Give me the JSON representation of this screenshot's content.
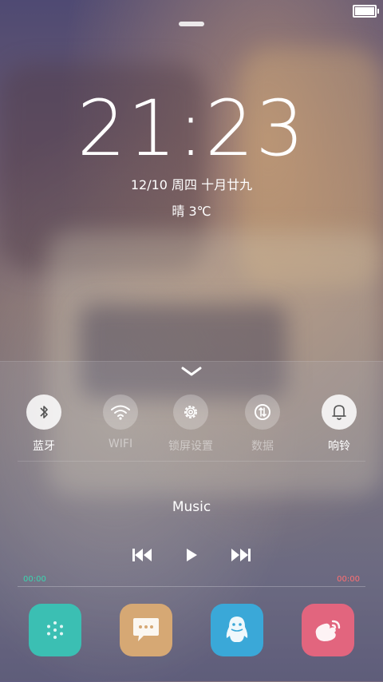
{
  "status_bar": {
    "battery_icon": "battery-full-icon"
  },
  "clock": {
    "hour": "21",
    "separator": ":",
    "minute": "23"
  },
  "date_line": "12/10 周四 十月廿九",
  "weather": "晴 3℃",
  "quick_toggles": [
    {
      "label": "蓝牙",
      "icon": "bluetooth-icon",
      "active": true
    },
    {
      "label": "WIFI",
      "icon": "wifi-icon",
      "active": false
    },
    {
      "label": "锁屏设置",
      "icon": "gear-icon",
      "active": false
    },
    {
      "label": "数据",
      "icon": "mobile-data-icon",
      "active": false
    },
    {
      "label": "响铃",
      "icon": "bell-icon",
      "active": true
    }
  ],
  "music": {
    "title": "Music",
    "elapsed": "00:00",
    "remaining": "00:00",
    "progress": 0
  },
  "dock": [
    {
      "icon": "app-drawer-icon",
      "color": "#3bbfb3"
    },
    {
      "icon": "messages-icon",
      "color": "#d6a874"
    },
    {
      "icon": "qq-penguin-icon",
      "color": "#3aa8d8"
    },
    {
      "icon": "weibo-icon",
      "color": "#e2657e"
    }
  ],
  "colors": {
    "elapsed": "#3ad6b0",
    "remaining": "#ff6f72"
  }
}
